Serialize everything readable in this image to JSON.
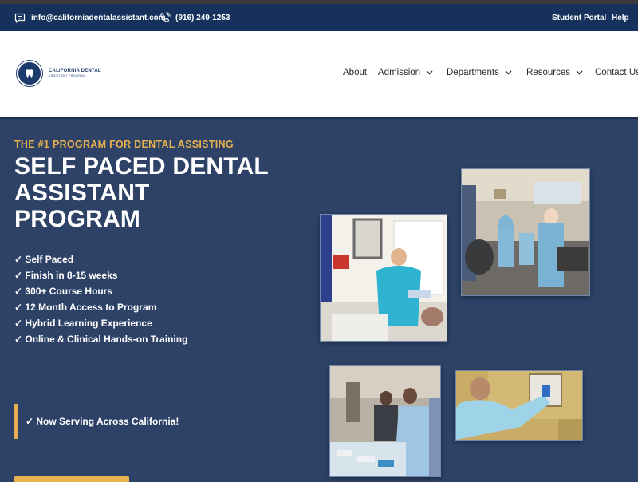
{
  "topbar": {
    "email": "info@californiadentalassistant.com",
    "phone": "(916) 249-1253",
    "links": [
      "Student Portal",
      "Help"
    ],
    "icons": {
      "email": "chat-bubble-icon",
      "phone": "phone-icon"
    }
  },
  "logo": {
    "line1": "CALIFORNIA DENTAL",
    "line2": "ASSISTANT PROGRAM"
  },
  "nav": {
    "items": [
      {
        "label": "About"
      },
      {
        "label": "Admission"
      },
      {
        "label": "Departments"
      },
      {
        "label": "Resources"
      },
      {
        "label": "Contact Us"
      }
    ]
  },
  "hero": {
    "tagline": "THE #1 PROGRAM FOR DENTAL ASSISTING",
    "headline_lines": [
      "SELF PACED DENTAL",
      "ASSISTANT",
      "PROGRAM"
    ],
    "features": [
      "✓ Self Paced",
      "✓ Finish in 8-15 weeks",
      "✓ 300+ Course Hours",
      "✓ 12 Month Access to Program",
      "✓ Hybrid Learning Experience",
      "✓ Online & Clinical Hands-on Training"
    ],
    "serving": "✓ Now Serving Across California!"
  },
  "colors": {
    "topbar": "#16325c",
    "hero_bg": "#2d4266",
    "accent": "#e8b04e",
    "nav_text": "#2a2a2a",
    "white": "#ffffff"
  }
}
